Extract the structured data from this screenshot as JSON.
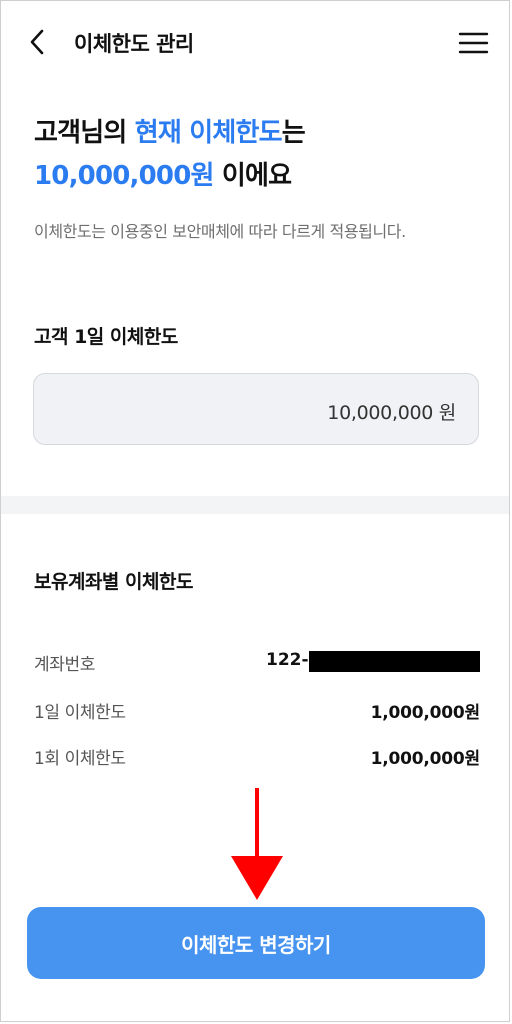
{
  "header": {
    "title": "이체한도 관리",
    "back_icon": "chevron-left-icon",
    "menu_icon": "hamburger-menu-icon"
  },
  "summary": {
    "line1_prefix": "고객님의 ",
    "line1_highlight": "현재 이체한도",
    "line1_suffix": "는",
    "line2_highlight": "10,000,000원",
    "line2_suffix": " 이에요",
    "description": "이체한도는 이용중인 보안매체에 따라 다르게 적용됩니다."
  },
  "daily_limit": {
    "label": "고객 1일 이체한도",
    "value": "10,000,000 원"
  },
  "account_limits": {
    "title": "보유계좌별 이체한도",
    "rows": [
      {
        "label": "계좌번호",
        "value": "122-"
      },
      {
        "label": "1일 이체한도",
        "value": "1,000,000원"
      },
      {
        "label": "1회 이체한도",
        "value": "1,000,000원"
      }
    ]
  },
  "cta": {
    "label": "이체한도 변경하기"
  },
  "colors": {
    "accent": "#2b7cf0",
    "button": "#4794f0",
    "arrow": "#ff0000"
  }
}
